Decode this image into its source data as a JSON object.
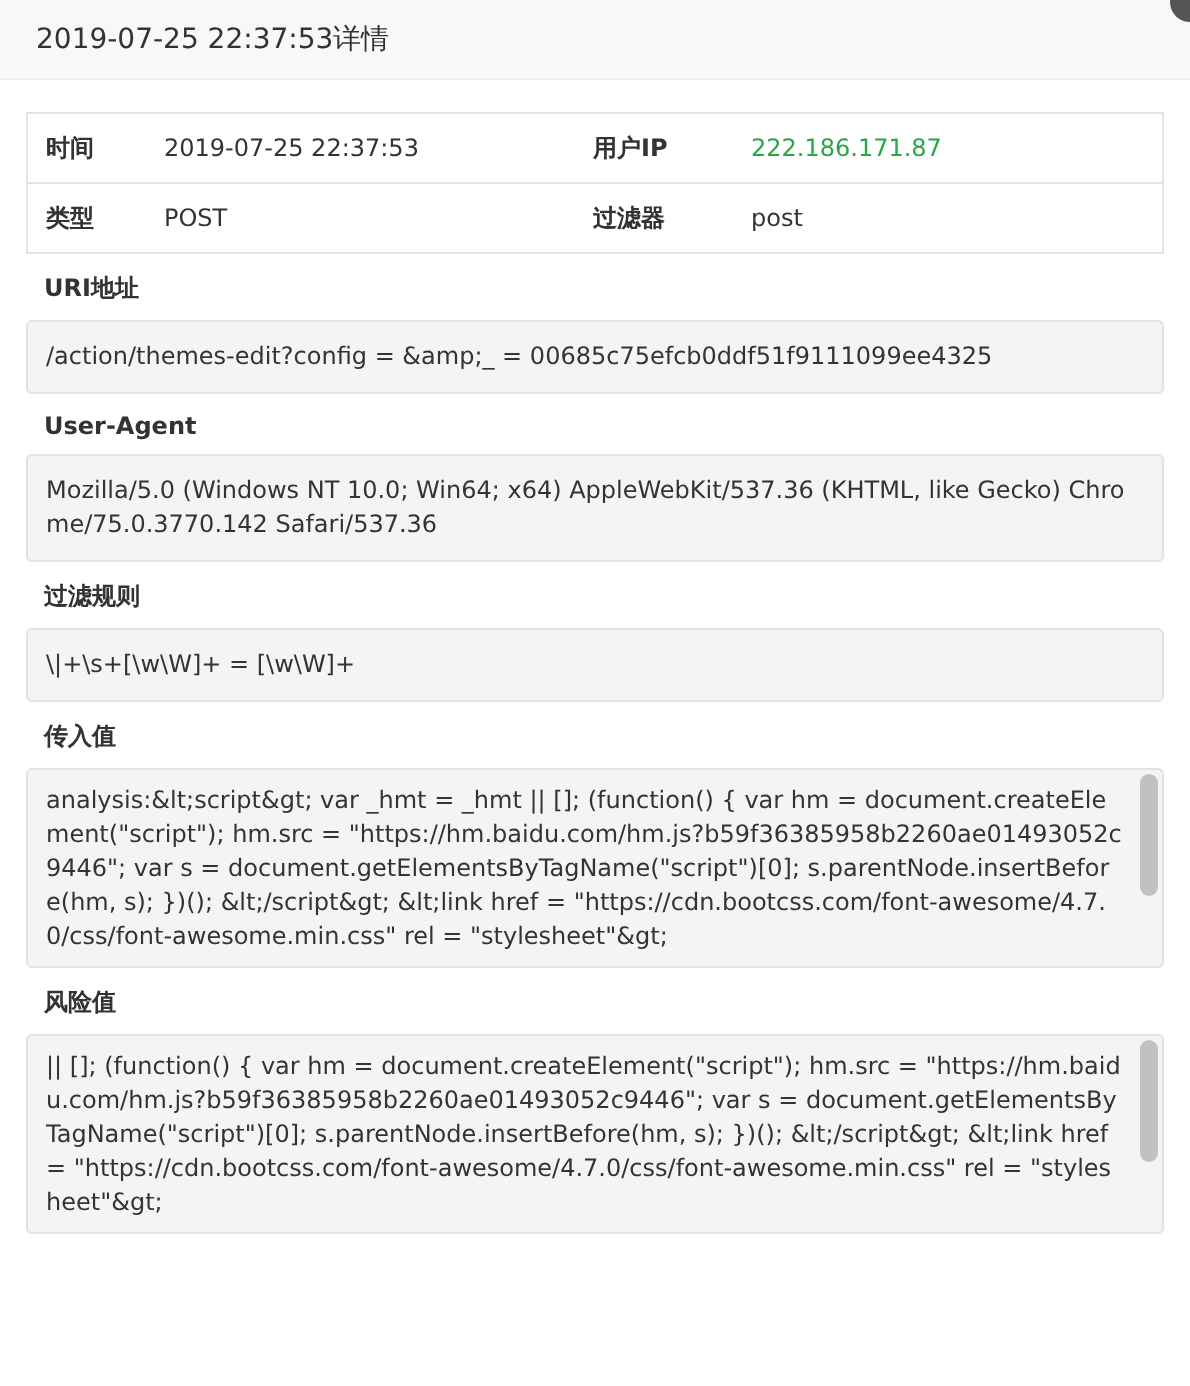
{
  "dialog": {
    "title": "2019-07-25 22:37:53详情"
  },
  "info_table": {
    "rows": [
      {
        "cells": [
          {
            "label": "时间",
            "value": "2019-07-25 22:37:53",
            "highlight": false
          },
          {
            "label": "用户IP",
            "value": "222.186.171.87",
            "highlight": true
          }
        ]
      },
      {
        "cells": [
          {
            "label": "类型",
            "value": "POST",
            "highlight": false
          },
          {
            "label": "过滤器",
            "value": "post",
            "highlight": false
          }
        ]
      }
    ]
  },
  "sections": [
    {
      "label": "URI地址",
      "kind": "field",
      "value": "/action/themes-edit?config = &amp;_ = 00685c75efcb0ddf51f9111099ee4325"
    },
    {
      "label": "User-Agent",
      "kind": "field",
      "value": "Mozilla/5.0 (Windows NT 10.0; Win64; x64) AppleWebKit/537.36 (KHTML, like Gecko) Chrome/75.0.3770.142 Safari/537.36"
    },
    {
      "label": "过滤规则",
      "kind": "field",
      "value": "\\|+\\s+[\\w\\W]+ = [\\w\\W]+"
    },
    {
      "label": "传入值",
      "kind": "textarea",
      "value": "analysis:&lt;script&gt; var _hmt  =  _hmt || []; (function() { var hm  =  document.createElement(\"script\"); hm.src  =  \"https://hm.baidu.com/hm.js?b59f36385958b2260ae01493052c9446\"; var s  =  document.getElementsByTagName(\"script\")[0]; s.parentNode.insertBefore(hm, s); })(); &lt;/script&gt; &lt;link href = \"https://cdn.bootcss.com/font-awesome/4.7.0/css/font-awesome.min.css\"  rel = \"stylesheet\"&gt;"
    },
    {
      "label": "风险值",
      "kind": "textarea",
      "value": "|| []; (function() { var hm  =  document.createElement(\"script\"); hm.src  =  \"https://hm.baidu.com/hm.js?b59f36385958b2260ae01493052c9446\"; var s  =  document.getElementsByTagName(\"script\")[0]; s.parentNode.insertBefore(hm, s); })(); &lt;/script&gt; &lt;link href = \"https://cdn.bootcss.com/font-awesome/4.7.0/css/font-awesome.min.css\"  rel  = \"stylesheet\"&gt;"
    }
  ]
}
